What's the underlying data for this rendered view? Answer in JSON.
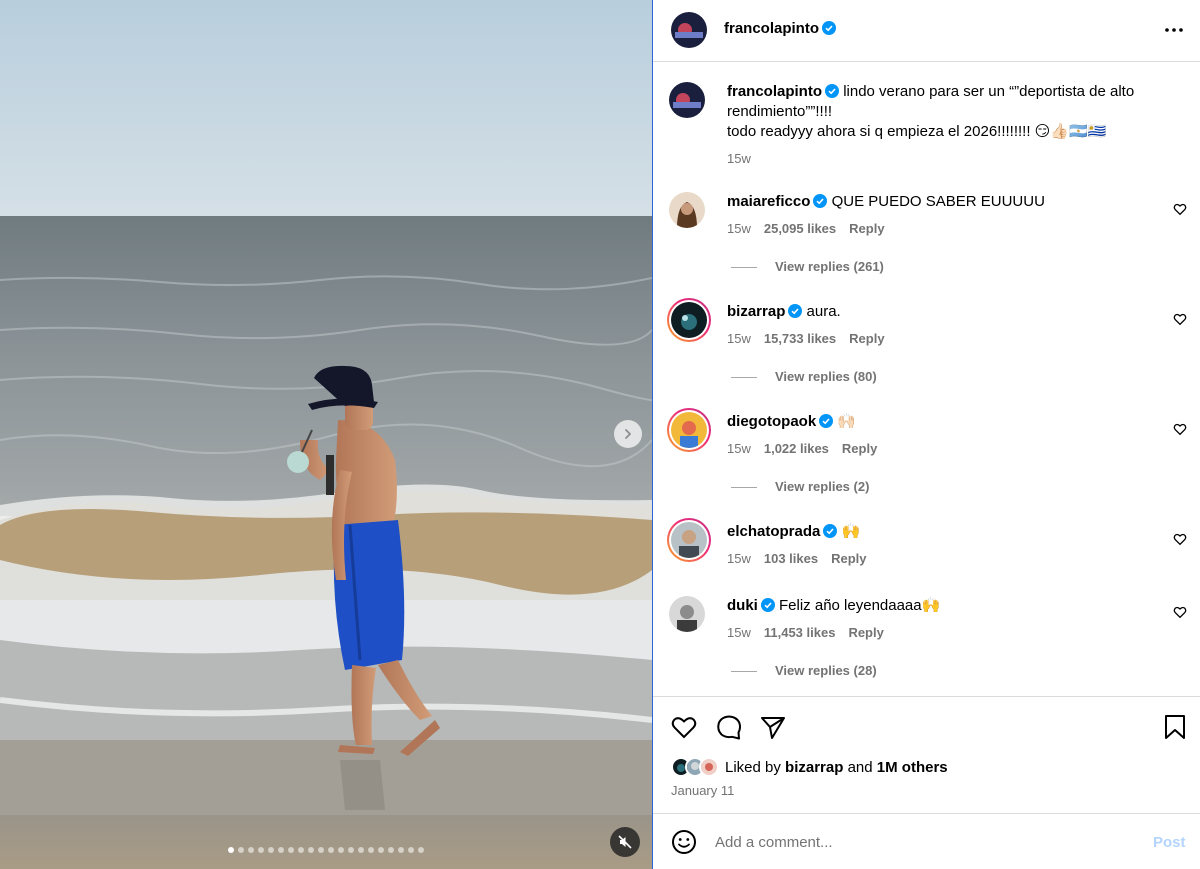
{
  "post": {
    "username": "francolapinto",
    "caption_line1": "lindo verano para ser un “”deportista de alto rendimiento””!!!!",
    "caption_line2": "todo readyyy ahora si q empieza el 2026!!!!!!!! 😏👍🏻🇦🇷🇺🇾",
    "caption_time": "15w",
    "liked_by_prefix": "Liked by",
    "liked_by_user": "bizarrap",
    "liked_by_and": "and",
    "liked_by_count": "1M others",
    "date": "January 11",
    "carousel_total": 20,
    "carousel_index": 1
  },
  "comments": [
    {
      "user": "maiareficco",
      "text": "QUE PUEDO SABER EUUUUU",
      "time": "15w",
      "likes": "25,095 likes",
      "reply": "Reply",
      "view_replies": "View replies (261)"
    },
    {
      "user": "bizarrap",
      "text": "aura.",
      "time": "15w",
      "likes": "15,733 likes",
      "reply": "Reply",
      "view_replies": "View replies (80)"
    },
    {
      "user": "diegotopaok",
      "text": "🙌🏻",
      "time": "15w",
      "likes": "1,022 likes",
      "reply": "Reply",
      "view_replies": "View replies (2)"
    },
    {
      "user": "elchatoprada",
      "text": "🙌",
      "time": "15w",
      "likes": "103 likes",
      "reply": "Reply"
    },
    {
      "user": "duki",
      "text": "Feliz año leyendaaaa🙌",
      "time": "15w",
      "likes": "11,453 likes",
      "reply": "Reply",
      "view_replies": "View replies (28)"
    }
  ],
  "composer": {
    "placeholder": "Add a comment...",
    "post_label": "Post"
  },
  "colors": {
    "verified": "#0095f6",
    "link_disabled": "#b3d4fc",
    "muted": "#737373"
  },
  "icons": [
    "more-options-icon",
    "heart-icon",
    "comment-icon",
    "share-icon",
    "bookmark-icon",
    "emoji-icon",
    "chevron-right-icon",
    "mute-icon",
    "verified-icon"
  ]
}
